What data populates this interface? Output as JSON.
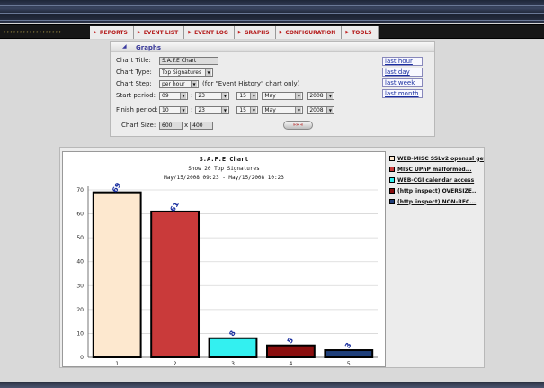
{
  "nav": {
    "dots": "▸▸▸▸▸▸▸▸▸▸▸▸▸▸▸▸▸▸",
    "tabs": [
      {
        "label": "REPORTS",
        "icon": "arrow-right-icon"
      },
      {
        "label": "EVENT LIST",
        "icon": "arrow-right-icon"
      },
      {
        "label": "EVENT LOG",
        "icon": "arrow-right-icon"
      },
      {
        "label": "GRAPHS",
        "icon": "arrow-right-icon"
      },
      {
        "label": "CONFIGURATION",
        "icon": "arrow-right-icon"
      },
      {
        "label": "TOOLS",
        "icon": "arrow-right-icon"
      }
    ]
  },
  "graphs": {
    "title": "Graphs",
    "chart_title_label": "Chart Title:",
    "chart_title_value": "S.A.F.E Chart",
    "chart_type_label": "Chart Type:",
    "chart_type_value": "Top Signatures",
    "chart_step_label": "Chart Step:",
    "chart_step_value": "per hour",
    "chart_step_hint": "(for \"Event History\" chart only)",
    "start_label": "Start period:",
    "start": {
      "hour": "09",
      "minute": "23",
      "day": "15",
      "month": "May",
      "year": "2008"
    },
    "finish_label": "Finish period:",
    "finish": {
      "hour": "10",
      "minute": "23",
      "day": "15",
      "month": "May",
      "year": "2008"
    },
    "size_label": "Chart Size:",
    "width": "600",
    "x": "x",
    "height": "400",
    "go_label": "»» «",
    "quick_links": [
      "last hour",
      "last day",
      "last week",
      "last month"
    ]
  },
  "chart_data": {
    "type": "bar",
    "title": "S.A.F.E Chart",
    "subtitle": "Show 20 Top Signatures",
    "range": "May/15/2008 09:23 - May/15/2008 10:23",
    "categories": [
      "1",
      "2",
      "3",
      "4",
      "5"
    ],
    "values": [
      69,
      61,
      8,
      5,
      3
    ],
    "colors": [
      "#fde8cf",
      "#c93a3a",
      "#33f0f0",
      "#8a0e0e",
      "#1f3f7a"
    ],
    "ylim": [
      0,
      70
    ],
    "yticks": [
      0,
      10,
      20,
      30,
      40,
      50,
      60,
      70
    ],
    "grid": true,
    "legend": [
      "WEB-MISC SSLv2 openssl get...",
      "MISC UPnP malformed...",
      "WEB-CGI calendar access",
      "(http_inspect) OVERSIZE...",
      "(http_inspect) NON-RFC..."
    ]
  }
}
